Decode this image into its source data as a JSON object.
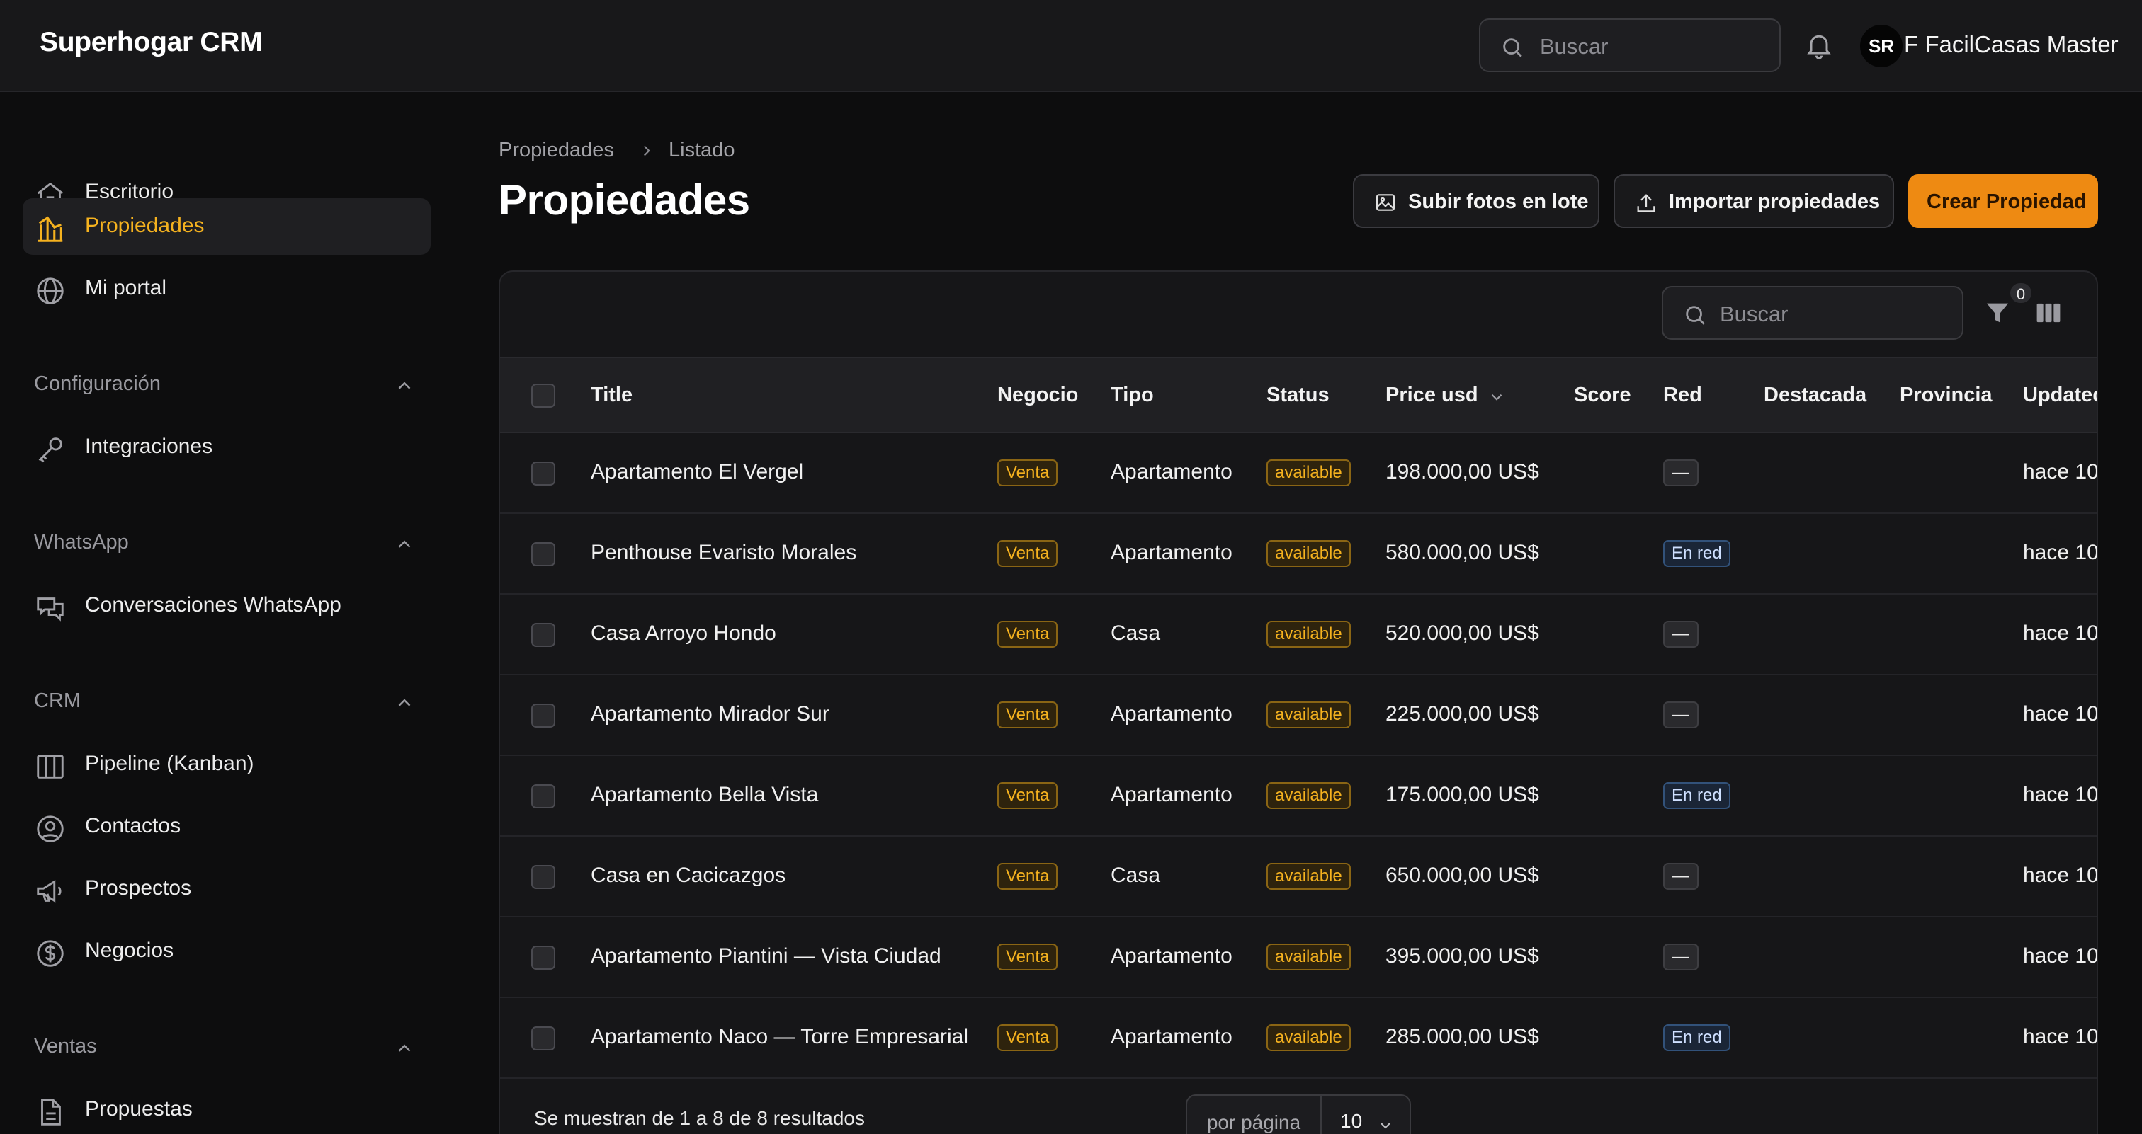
{
  "app": {
    "title": "Superhogar CRM"
  },
  "header": {
    "search_placeholder": "Buscar",
    "user_initials": "SR",
    "user_name": "F FacilCasas Master"
  },
  "sidebar": {
    "items_top": [
      {
        "label": "Escritorio",
        "icon": "home-icon",
        "active": false
      },
      {
        "label": "Propiedades",
        "icon": "chart-building-icon",
        "active": true
      },
      {
        "label": "Mi portal",
        "icon": "globe-icon",
        "active": false
      }
    ],
    "groups": [
      {
        "label": "Configuración",
        "items": [
          {
            "label": "Integraciones",
            "icon": "key-icon"
          }
        ]
      },
      {
        "label": "WhatsApp",
        "items": [
          {
            "label": "Conversaciones WhatsApp",
            "icon": "chat-bubbles-icon"
          }
        ]
      },
      {
        "label": "CRM",
        "items": [
          {
            "label": "Pipeline (Kanban)",
            "icon": "columns-icon"
          },
          {
            "label": "Contactos",
            "icon": "user-circle-icon"
          },
          {
            "label": "Prospectos",
            "icon": "megaphone-icon"
          },
          {
            "label": "Negocios",
            "icon": "dollar-circle-icon"
          }
        ]
      },
      {
        "label": "Ventas",
        "items": [
          {
            "label": "Propuestas",
            "icon": "document-icon"
          }
        ]
      }
    ]
  },
  "breadcrumb": {
    "parent": "Propiedades",
    "current": "Listado"
  },
  "page": {
    "title": "Propiedades"
  },
  "actions": {
    "bulk_upload": "Subir fotos en lote",
    "import": "Importar propiedades",
    "create": "Crear Propiedad"
  },
  "table": {
    "search_placeholder": "Buscar",
    "filter_count": "0",
    "columns": {
      "title": "Title",
      "negocio": "Negocio",
      "tipo": "Tipo",
      "status": "Status",
      "price": "Price usd",
      "score": "Score",
      "red": "Red",
      "destacada": "Destacada",
      "provincia": "Provincia",
      "updated": "Updated"
    },
    "rows": [
      {
        "title": "Apartamento El Vergel",
        "negocio": "Venta",
        "tipo": "Apartamento",
        "status": "available",
        "price": "198.000,00 US$",
        "red": "—",
        "updated": "hace 10"
      },
      {
        "title": "Penthouse Evaristo Morales",
        "negocio": "Venta",
        "tipo": "Apartamento",
        "status": "available",
        "price": "580.000,00 US$",
        "red": "En red",
        "updated": "hace 10"
      },
      {
        "title": "Casa Arroyo Hondo",
        "negocio": "Venta",
        "tipo": "Casa",
        "status": "available",
        "price": "520.000,00 US$",
        "red": "—",
        "updated": "hace 10"
      },
      {
        "title": "Apartamento Mirador Sur",
        "negocio": "Venta",
        "tipo": "Apartamento",
        "status": "available",
        "price": "225.000,00 US$",
        "red": "—",
        "updated": "hace 10"
      },
      {
        "title": "Apartamento Bella Vista",
        "negocio": "Venta",
        "tipo": "Apartamento",
        "status": "available",
        "price": "175.000,00 US$",
        "red": "En red",
        "updated": "hace 10"
      },
      {
        "title": "Casa en Cacicazgos",
        "negocio": "Venta",
        "tipo": "Casa",
        "status": "available",
        "price": "650.000,00 US$",
        "red": "—",
        "updated": "hace 10"
      },
      {
        "title": "Apartamento Piantini — Vista Ciudad",
        "negocio": "Venta",
        "tipo": "Apartamento",
        "status": "available",
        "price": "395.000,00 US$",
        "red": "—",
        "updated": "hace 10"
      },
      {
        "title": "Apartamento Naco — Torre Empresarial",
        "negocio": "Venta",
        "tipo": "Apartamento",
        "status": "available",
        "price": "285.000,00 US$",
        "red": "En red",
        "updated": "hace 10"
      }
    ],
    "footer_text": "Se muestran de 1 a 8 de 8 resultados",
    "per_page_label": "por página",
    "per_page_value": "10"
  },
  "colors": {
    "accent": "#f5b21f",
    "primary_button": "#ee8a12",
    "background": "#0d0d0e"
  }
}
